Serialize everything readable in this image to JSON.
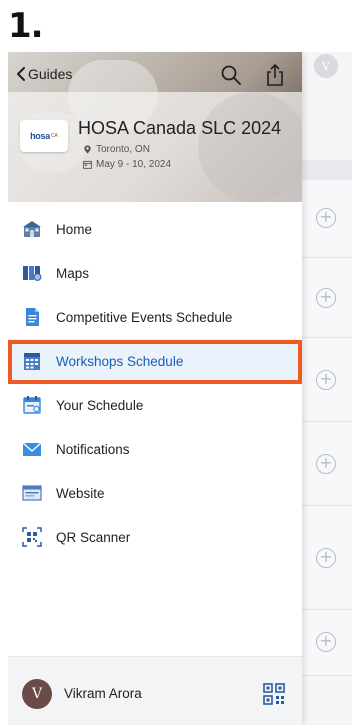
{
  "step_label": "1.",
  "header": {
    "back_label": "Guides",
    "event_title": "HOSA Canada SLC 2024",
    "location": "Toronto, ON",
    "dates": "May 9 - 10, 2024",
    "logo_text": "hosa",
    "logo_sub": "CA"
  },
  "nav": {
    "items": [
      {
        "label": "Home",
        "icon": "home-icon"
      },
      {
        "label": "Maps",
        "icon": "maps-icon"
      },
      {
        "label": "Competitive Events Schedule",
        "icon": "document-icon"
      },
      {
        "label": "Workshops Schedule",
        "icon": "calendar-list-icon"
      },
      {
        "label": "Your Schedule",
        "icon": "calendar-icon"
      },
      {
        "label": "Notifications",
        "icon": "mail-icon"
      },
      {
        "label": "Website",
        "icon": "browser-icon"
      },
      {
        "label": "QR Scanner",
        "icon": "qr-scan-icon"
      }
    ],
    "active_index": 3
  },
  "footer": {
    "user_initial": "V",
    "user_name": "Vikram Arora"
  },
  "background": {
    "avatar_initial": "V"
  },
  "colors": {
    "accent": "#1a5fb4",
    "highlight": "#ef5a24",
    "active_bg": "#eaf2fb"
  }
}
